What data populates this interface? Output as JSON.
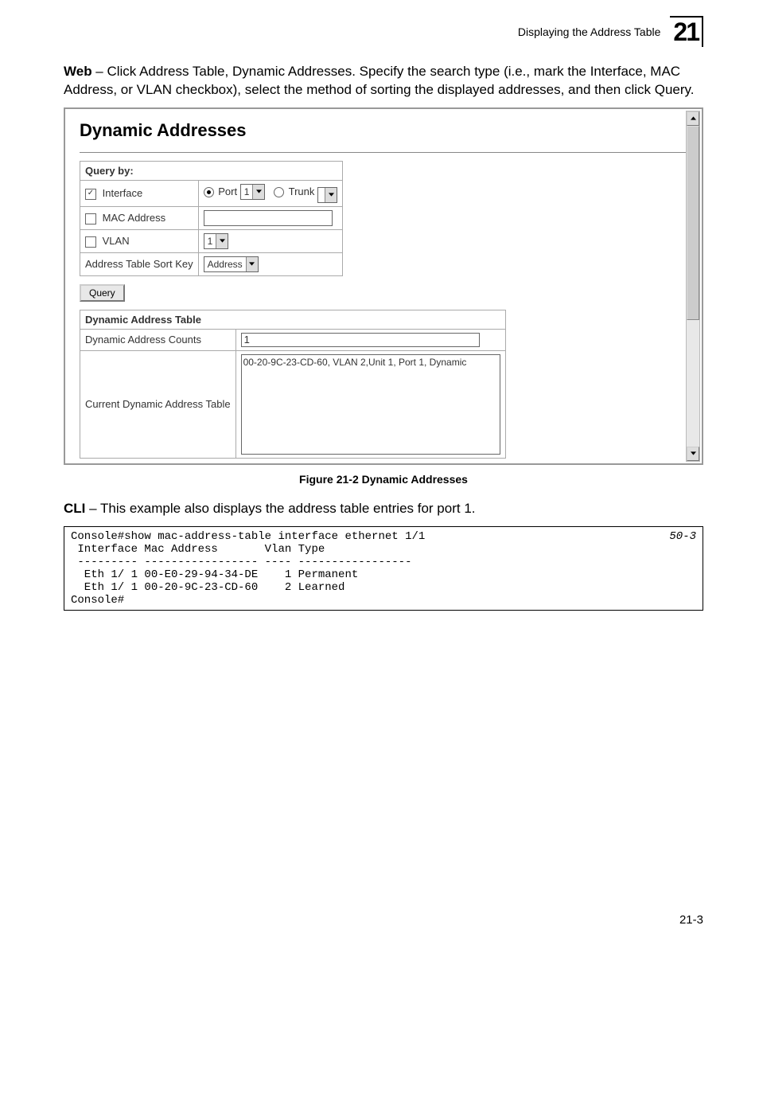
{
  "header": {
    "section_title": "Displaying the Address Table",
    "chapter_number": "21"
  },
  "intro": {
    "lead": "Web",
    "text": " – Click Address Table, Dynamic Addresses. Specify the search type (i.e., mark the Interface, MAC Address, or VLAN checkbox), select the method of sorting the displayed addresses, and then click Query."
  },
  "screenshot": {
    "title": "Dynamic Addresses",
    "query_by_label": "Query by:",
    "rows": {
      "interface": {
        "label": "Interface",
        "port_label": "Port",
        "port_value": "1",
        "trunk_label": "Trunk",
        "trunk_value": ""
      },
      "mac": {
        "label": "MAC Address"
      },
      "vlan": {
        "label": "VLAN",
        "value": "1"
      },
      "sort": {
        "label": "Address Table Sort Key",
        "value": "Address"
      }
    },
    "query_btn": "Query",
    "addr_table": {
      "header": "Dynamic Address Table",
      "counts_label": "Dynamic Address Counts",
      "counts_value": "1",
      "current_label": "Current Dynamic Address Table",
      "entry": "00-20-9C-23-CD-60, VLAN 2,Unit 1, Port 1, Dynamic"
    }
  },
  "figure_caption": "Figure 21-2  Dynamic Addresses",
  "cli": {
    "lead": "CLI",
    "text": " – This example also displays the address table entries for port 1.",
    "ref": "50-3",
    "body": "Console#show mac-address-table interface ethernet 1/1\n Interface Mac Address       Vlan Type\n --------- ----------------- ---- -----------------\n  Eth 1/ 1 00-E0-29-94-34-DE    1 Permanent\n  Eth 1/ 1 00-20-9C-23-CD-60    2 Learned\nConsole#"
  },
  "page_number": "21-3"
}
